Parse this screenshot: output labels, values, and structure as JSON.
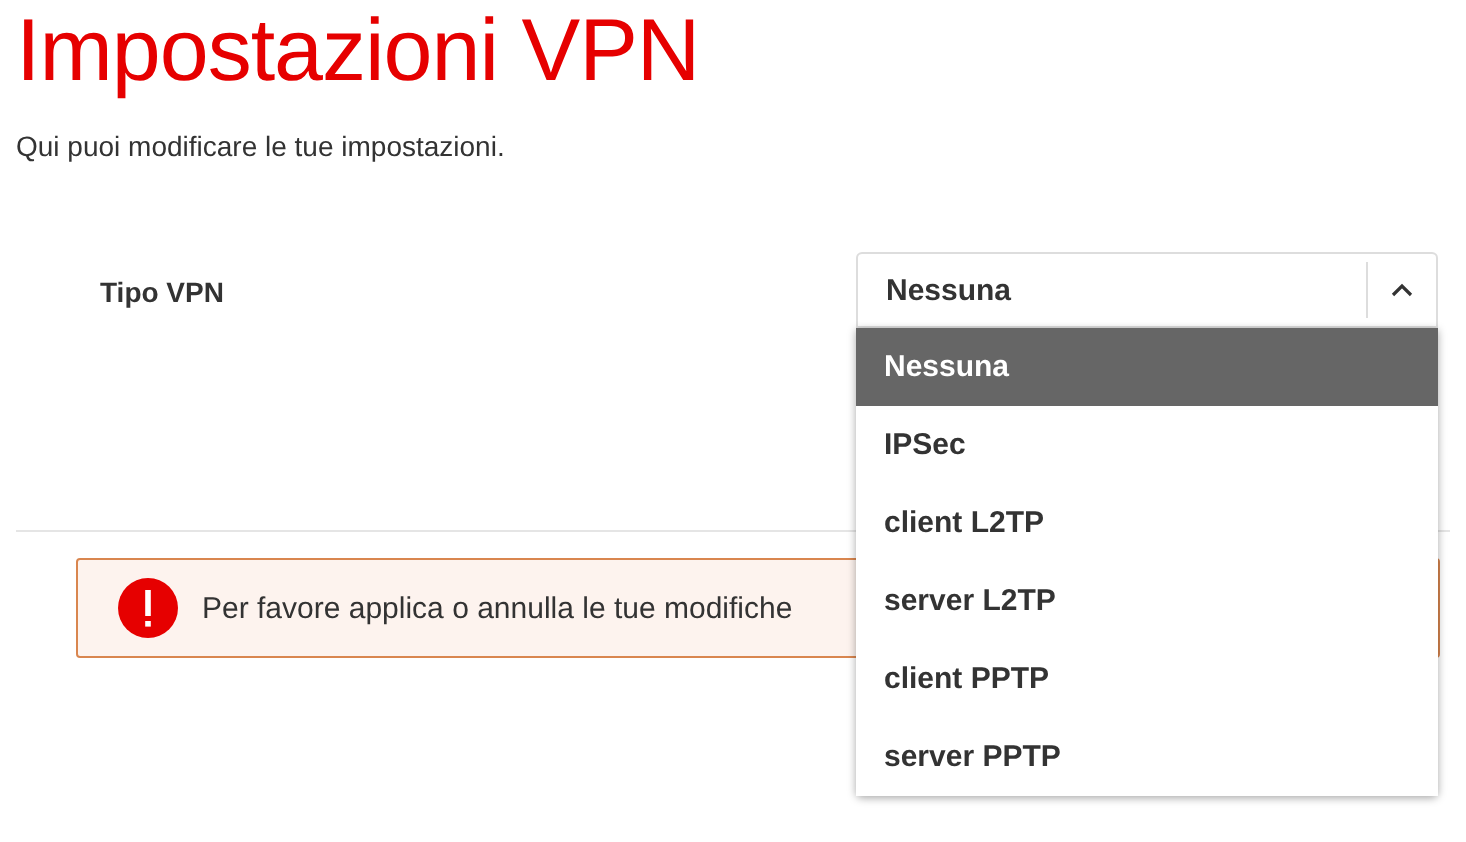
{
  "title": "Impostazioni VPN",
  "subtitle": "Qui puoi modificare le tue impostazioni.",
  "fields": [
    {
      "label": "Tipo VPN",
      "kind": "select",
      "value": "Nessuna",
      "expanded": true,
      "options": [
        {
          "label": "Nessuna",
          "selected": true
        },
        {
          "label": "IPSec",
          "selected": false
        },
        {
          "label": "client L2TP",
          "selected": false
        },
        {
          "label": "server L2TP",
          "selected": false
        },
        {
          "label": "client PPTP",
          "selected": false
        },
        {
          "label": "server PPTP",
          "selected": false
        }
      ]
    }
  ],
  "alert": {
    "kind": "error",
    "message": "Per favore applica o annulla le tue modifiche"
  }
}
